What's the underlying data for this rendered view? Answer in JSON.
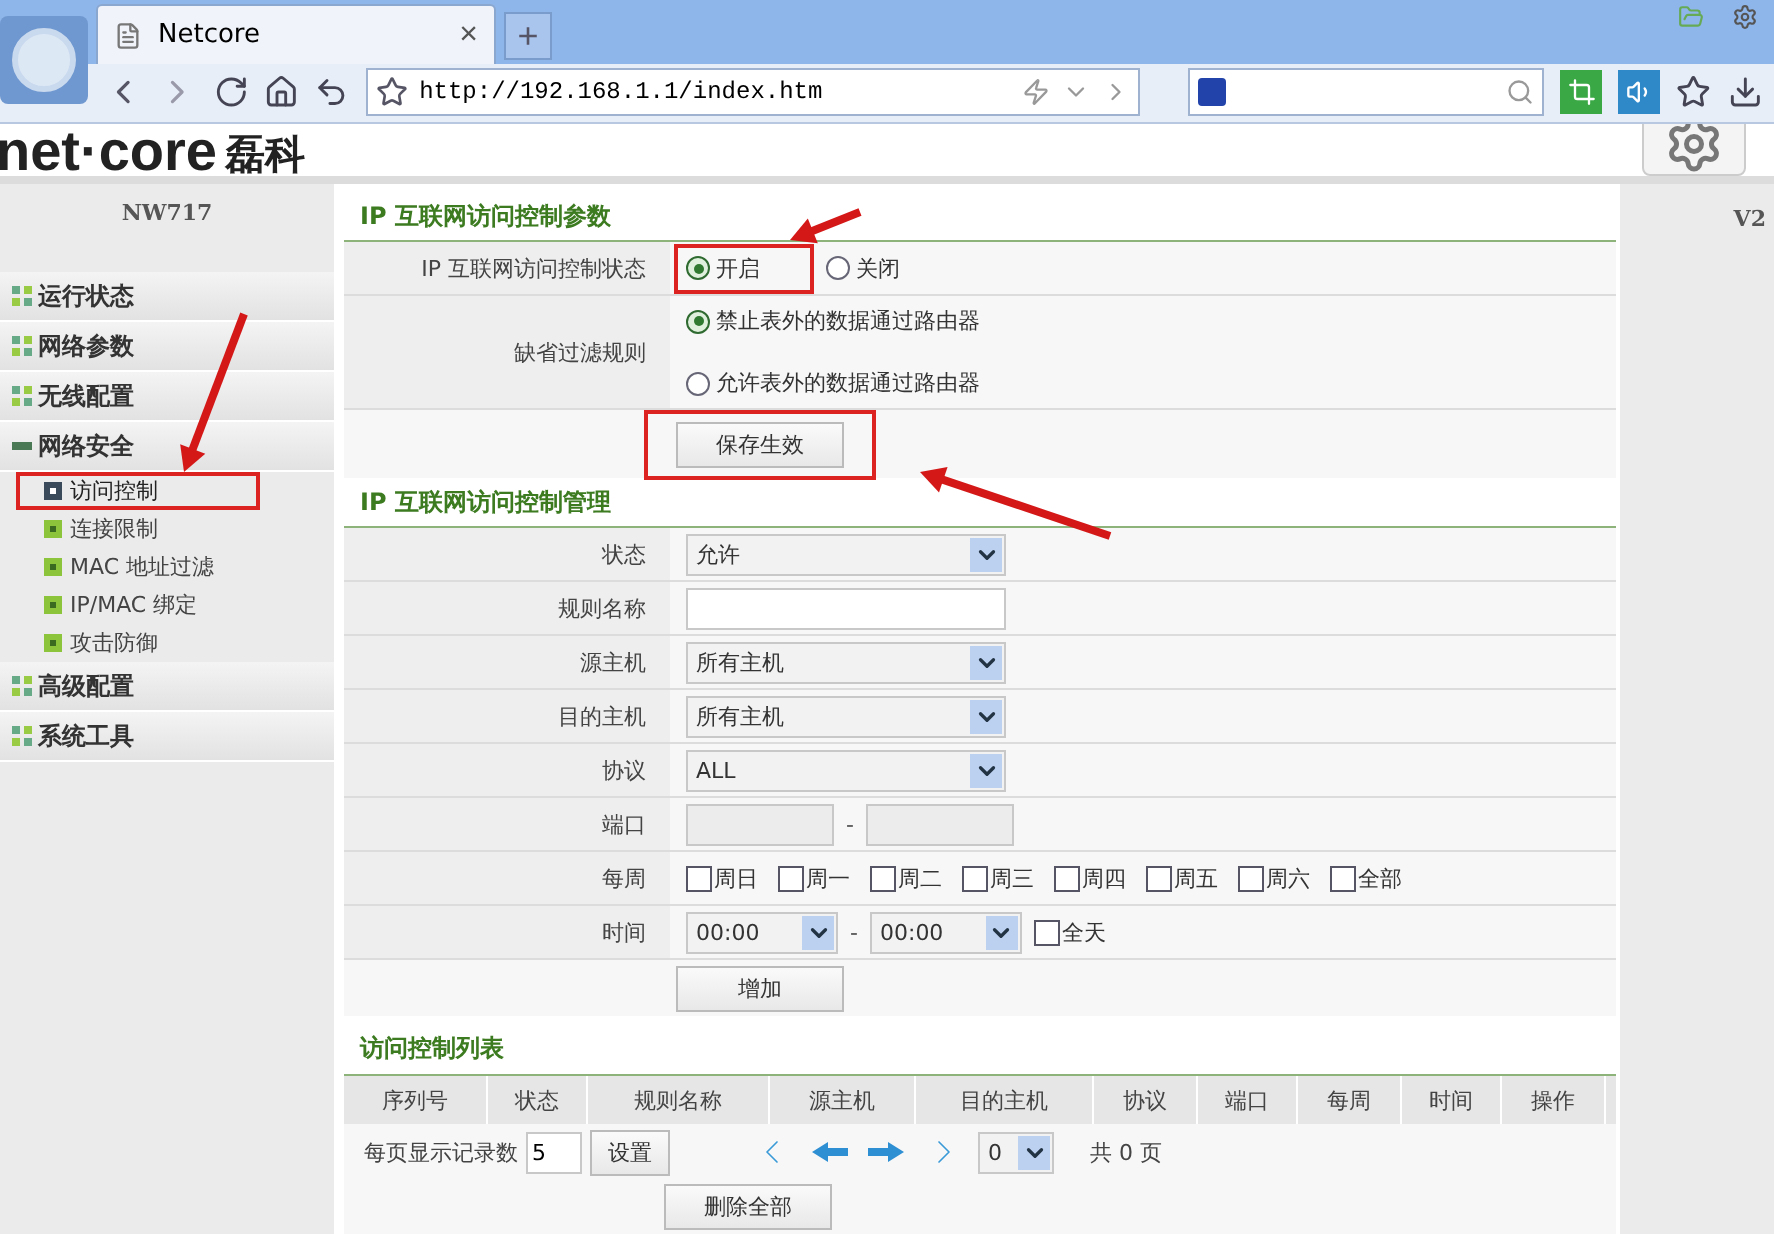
{
  "browser": {
    "tab": {
      "title": "Netcore",
      "close": "×"
    },
    "new_tab": "+",
    "url": "http://192.168.1.1/index.htm"
  },
  "header": {
    "logo": "net·core",
    "logo_cn": "磊科"
  },
  "sidebar": {
    "model": "NW717",
    "items": [
      {
        "label": "运行状态",
        "expanded": false
      },
      {
        "label": "网络参数",
        "expanded": false
      },
      {
        "label": "无线配置",
        "expanded": false
      },
      {
        "label": "网络安全",
        "expanded": true,
        "children": [
          {
            "label": "访问控制",
            "selected": true,
            "highlighted": true
          },
          {
            "label": "连接限制",
            "selected": false,
            "highlighted": false
          },
          {
            "label": "MAC 地址过滤",
            "selected": false,
            "highlighted": false
          },
          {
            "label": "IP/MAC 绑定",
            "selected": false,
            "highlighted": false
          },
          {
            "label": "攻击防御",
            "selected": false,
            "highlighted": false
          }
        ]
      },
      {
        "label": "高级配置",
        "expanded": false
      },
      {
        "label": "系统工具",
        "expanded": false
      }
    ]
  },
  "version": "V2",
  "params": {
    "title": "IP 互联网访问控制参数",
    "status": {
      "label": "IP 互联网访问控制状态",
      "options": [
        {
          "label": "开启",
          "selected": true,
          "highlighted": true
        },
        {
          "label": "关闭",
          "selected": false,
          "highlighted": false
        }
      ]
    },
    "default_rule": {
      "label": "缺省过滤规则",
      "options": [
        {
          "label": "禁止表外的数据通过路由器",
          "selected": true
        },
        {
          "label": "允许表外的数据通过路由器",
          "selected": false
        }
      ]
    },
    "save": {
      "label": "保存生效",
      "highlighted": true
    }
  },
  "manage": {
    "title": "IP 互联网访问控制管理",
    "rows": [
      {
        "kind": "select",
        "label": "状态",
        "value": "允许"
      },
      {
        "kind": "text",
        "label": "规则名称"
      },
      {
        "kind": "select",
        "label": "源主机",
        "value": "所有主机"
      },
      {
        "kind": "select",
        "label": "目的主机",
        "value": "所有主机"
      },
      {
        "kind": "select",
        "label": "协议",
        "value": "ALL"
      },
      {
        "kind": "range",
        "label": "端口",
        "separator": "-"
      },
      {
        "kind": "days",
        "label": "每周",
        "days": [
          {
            "label": "周日",
            "checked": false
          },
          {
            "label": "周一",
            "checked": false
          },
          {
            "label": "周二",
            "checked": false
          },
          {
            "label": "周三",
            "checked": false
          },
          {
            "label": "周四",
            "checked": false
          },
          {
            "label": "周五",
            "checked": false
          },
          {
            "label": "周六",
            "checked": false
          },
          {
            "label": "全部",
            "checked": false
          }
        ]
      },
      {
        "kind": "time",
        "label": "时间",
        "from": "00:00",
        "separator": "-",
        "to": "00:00",
        "all_day": {
          "label": "全天",
          "checked": false
        }
      }
    ],
    "add": "增加"
  },
  "list": {
    "title": "访问控制列表",
    "columns": [
      "序列号",
      "状态",
      "规则名称",
      "源主机",
      "目的主机",
      "协议",
      "端口",
      "每周",
      "时间",
      "操作"
    ],
    "pager": {
      "label": "每页显示记录数",
      "per_page": "5",
      "set": "设置",
      "page": "0",
      "total": "共 0 页"
    },
    "delete_all": "删除全部"
  }
}
